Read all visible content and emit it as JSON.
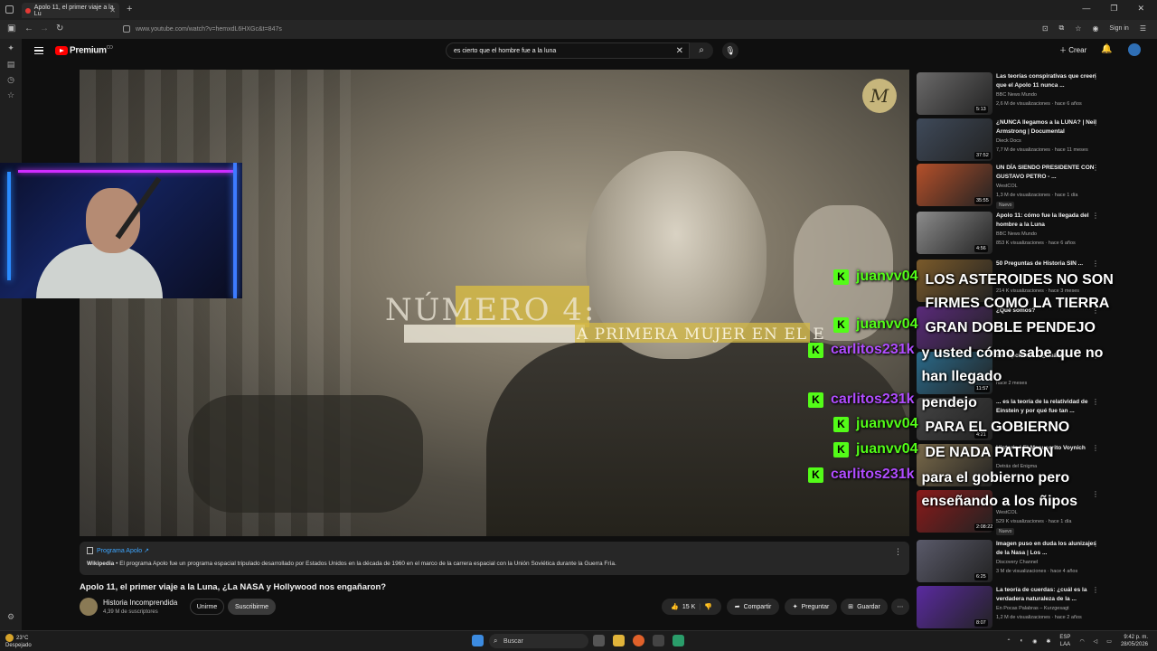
{
  "browser": {
    "tab_title": "Apolo 11, el primer viaje a la Lu",
    "url": "www.youtube.com/watch?v=hemxdL6HXGc&t=847s",
    "signin": "Sign in"
  },
  "youtube": {
    "brand": "Premium",
    "brand_sup": "CO",
    "search_query": "es cierto que el hombre fue a la luna",
    "create_label": "Crear"
  },
  "video_overlay": {
    "badge_letter": "M",
    "title": "NÚMERO 4:",
    "subtitle": "A PRIMERA MUJER EN EL E"
  },
  "info_panel": {
    "title": "Programa Apolo ↗",
    "source": "Wikipedia",
    "text": "El programa Apolo fue un programa espacial tripulado desarrollado por Estados Unidos en la década de 1960 en el marco de la carrera espacial con la Unión Soviética durante la Guerra Fría."
  },
  "video": {
    "title": "Apolo 11, el primer viaje a la Luna, ¿La NASA y Hollywood nos engañaron?",
    "channel": "Historia Incomprendida",
    "subscribers": "4,39 M de suscriptores",
    "join_label": "Unirme",
    "subscribe_label": "Suscribirme",
    "likes": "15 K",
    "share_label": "Compartir",
    "ask_label": "Preguntar",
    "save_label": "Guardar"
  },
  "recommendations": [
    {
      "title": "Las teorías conspirativas que creen que el Apolo 11 nunca ...",
      "channel": "BBC News Mundo",
      "meta": "2,6 M de visualizaciones · hace 6 años",
      "duration": "5:13",
      "badge": "",
      "color": "#6b6a6a"
    },
    {
      "title": "¿NUNCA llegamos a la LUNA? | Neil Armstrong | Documental",
      "channel": "Dieck Docs",
      "meta": "7,7 M de visualizaciones · hace 11 meses",
      "duration": "37:52",
      "badge": "",
      "color": "#3f4a5a"
    },
    {
      "title": "UN DÍA SIENDO PRESIDENTE CON GUSTAVO PETRO - ...",
      "channel": "WestCOL",
      "meta": "1,3 M de visualizaciones · hace 1 día",
      "duration": "35:55",
      "badge": "Nuevo",
      "color": "#b5502a"
    },
    {
      "title": "Apolo 11: cómo fue la llegada del hombre a la Luna",
      "channel": "BBC News Mundo",
      "meta": "853 K visualizaciones · hace 6 años",
      "duration": "4:56",
      "badge": "",
      "color": "#8c8c8c"
    },
    {
      "title": "50 Preguntas de Historia SIN ...",
      "channel": "",
      "meta": "214 K visualizaciones · hace 3 meses",
      "duration": "",
      "badge": "",
      "color": "#7a5a2a"
    },
    {
      "title": "¿Qué somos?",
      "channel": "",
      "meta": "",
      "duration": "",
      "badge": "",
      "color": "#5a2a7a"
    },
    {
      "title": "Sin Opciones ... ¿Cuánto ...",
      "channel": "",
      "meta": "hace 2 meses",
      "duration": "11:57",
      "badge": "",
      "color": "#2a6a8a"
    },
    {
      "title": "... es la teoría de la relatividad de Einstein y por qué fue tan ...",
      "channel": "",
      "meta": "",
      "duration": "4:21",
      "badge": "",
      "color": "#444"
    },
    {
      "title": "Historia | El Manuscrito Voynich",
      "channel": "Detrás del Enigma",
      "meta": "",
      "duration": "",
      "badge": "",
      "color": "#7a6a4a"
    },
    {
      "title": "",
      "channel": "WestCOL",
      "meta": "529 K visualizaciones · hace 1 día",
      "duration": "2:08:22",
      "badge": "Nuevo",
      "color": "#8a1a1a"
    },
    {
      "title": "Imagen puso en duda los alunizajes de la Nasa | Los ...",
      "channel": "Discovery Channel",
      "meta": "3 M de visualizaciones · hace 4 años",
      "duration": "6:25",
      "badge": "",
      "color": "#5a5a6a"
    },
    {
      "title": "La teoría de cuerdas: ¿cuál es la verdadera naturaleza de la ...",
      "channel": "En Pocas Palabras – Kurzgesagt",
      "meta": "1,2 M de visualizaciones · hace 2 años",
      "duration": "8:07",
      "badge": "",
      "color": "#5a2aa0"
    }
  ],
  "chat": [
    {
      "user": "juanvv04",
      "color": "#53fc18",
      "message": "LOS ASTEROIDES NO SON FIRMES COMO LA TIERRA"
    },
    {
      "user": "juanvv04",
      "color": "#53fc18",
      "message": "GRAN DOBLE PENDEJO"
    },
    {
      "user": "carlitos231k",
      "color": "#b04cff",
      "message": "y usted cómo sabe que no han llegado"
    },
    {
      "user": "carlitos231k",
      "color": "#b04cff",
      "message": "pendejo"
    },
    {
      "user": "juanvv04",
      "color": "#53fc18",
      "message": "PARA EL GOBIERNO"
    },
    {
      "user": "juanvv04",
      "color": "#53fc18",
      "message": "DE NADA PATRON"
    },
    {
      "user": "carlitos231k",
      "color": "#b04cff",
      "message": "para el gobierno pero enseñando a los ñipos"
    }
  ],
  "chat_badge": "K",
  "taskbar": {
    "temp": "23°C",
    "weather": "Despejado",
    "search_placeholder": "Buscar",
    "lang_top": "ESP",
    "lang_bottom": "LAA",
    "time": "9:42 p. m.",
    "date": "28/05/2026"
  }
}
